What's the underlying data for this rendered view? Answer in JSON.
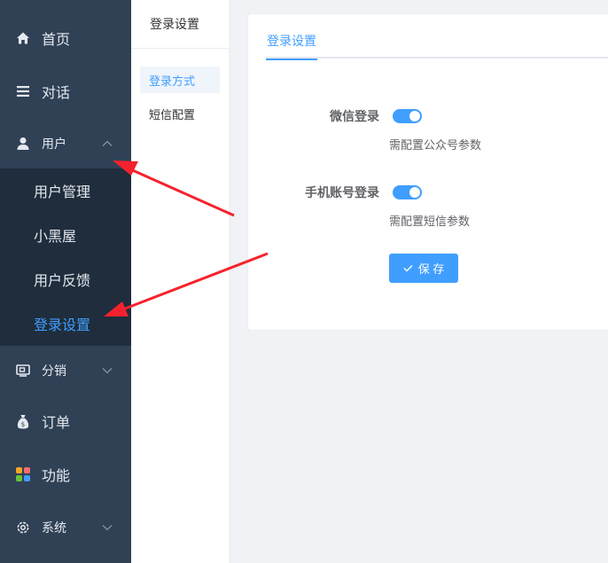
{
  "sidebar": {
    "items": [
      {
        "label": "首页",
        "icon": "home-icon"
      },
      {
        "label": "对话",
        "icon": "list-icon"
      },
      {
        "label": "用户",
        "icon": "user-icon"
      },
      {
        "label": "分销",
        "icon": "distribution-icon"
      },
      {
        "label": "订单",
        "icon": "money-bag-icon"
      },
      {
        "label": "功能",
        "icon": "grid-icon"
      },
      {
        "label": "系统",
        "icon": "gear-icon"
      }
    ],
    "user_submenu": [
      {
        "label": "用户管理"
      },
      {
        "label": "小黑屋"
      },
      {
        "label": "用户反馈"
      },
      {
        "label": "登录设置",
        "active": true
      }
    ]
  },
  "subnav": {
    "title": "登录设置",
    "items": [
      {
        "label": "登录方式",
        "active": true
      },
      {
        "label": "短信配置"
      }
    ]
  },
  "main": {
    "tab": "登录设置",
    "fields": [
      {
        "label": "微信登录",
        "enabled": true,
        "help": "需配置公众号参数"
      },
      {
        "label": "手机账号登录",
        "enabled": true,
        "help": "需配置短信参数"
      }
    ],
    "save_label": "保 存"
  },
  "colors": {
    "sidebar_bg": "#304156",
    "submenu_bg": "#1f2d3d",
    "accent": "#409eff",
    "annotation": "#f5222d"
  }
}
